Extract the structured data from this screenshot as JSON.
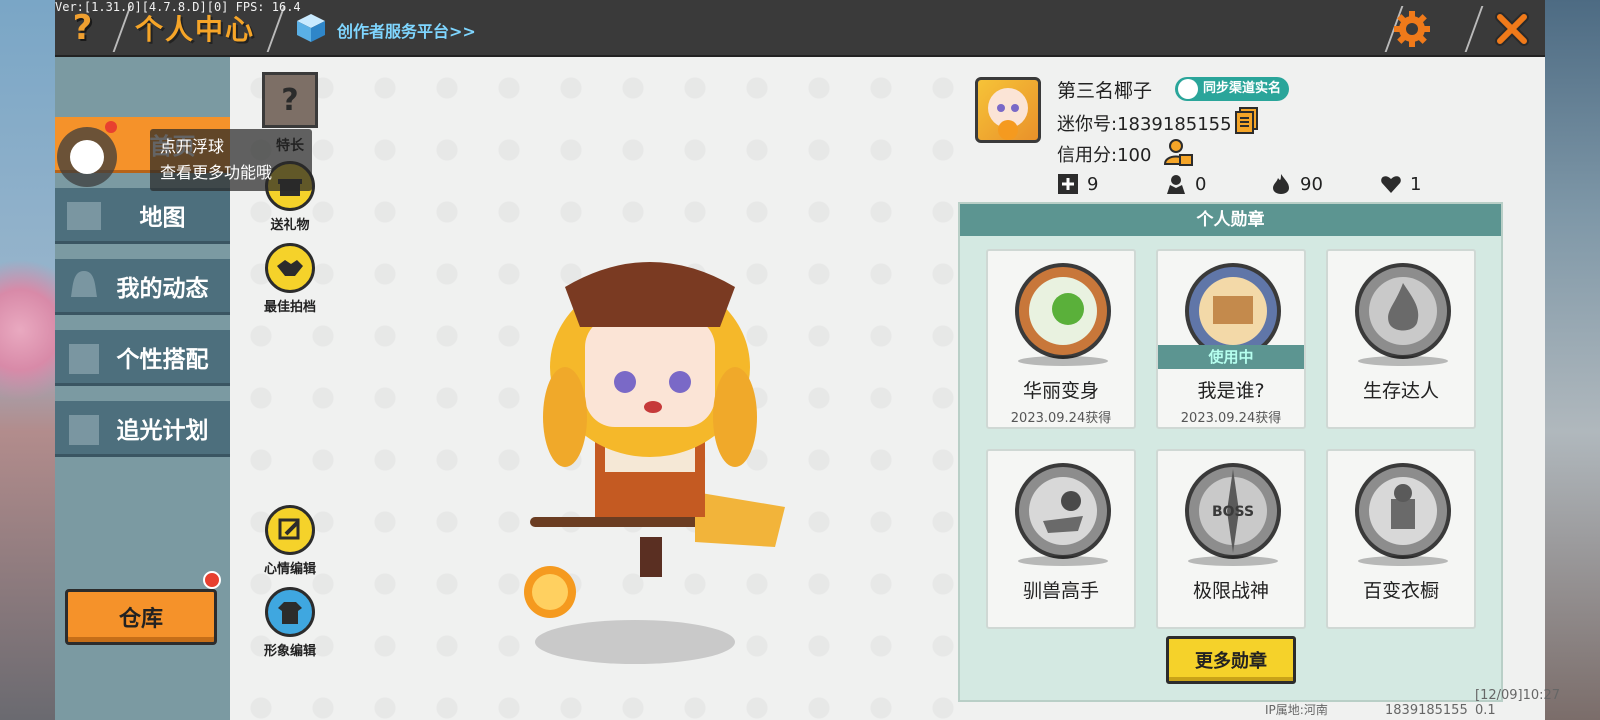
{
  "debug": {
    "version": "Ver:[1.31.0][4.7.8.D][0] FPS: 16.4"
  },
  "header": {
    "help_icon": "question-mark-icon",
    "title": "个人中心",
    "creator_link": "创作者服务平台>>",
    "settings_icon": "gear-icon",
    "close_icon": "close-icon"
  },
  "sidebar": {
    "items": [
      {
        "label": "首页",
        "active": true
      },
      {
        "label": "地图",
        "active": false
      },
      {
        "label": "我的动态",
        "active": false
      },
      {
        "label": "个性搭配",
        "active": false
      },
      {
        "label": "追光计划",
        "active": false
      }
    ],
    "warehouse_label": "仓库"
  },
  "floating_tip": {
    "line1": "点开浮球",
    "line2": "查看更多功能哦"
  },
  "center": {
    "skill_label": "特长",
    "actions": [
      {
        "label": "送礼物",
        "icon": "gift-icon"
      },
      {
        "label": "最佳拍档",
        "icon": "handshake-icon"
      },
      {
        "label": "心情编辑",
        "icon": "edit-icon"
      },
      {
        "label": "形象编辑",
        "icon": "outfit-icon"
      }
    ]
  },
  "profile": {
    "nickname": "第三名椰子",
    "verify_badge": "同步渠道实名",
    "mini_id": "迷你号:1839185155",
    "credit": "信用分:100",
    "stats": [
      {
        "icon": "plus-icon",
        "value": "9"
      },
      {
        "icon": "fans-icon",
        "value": "0"
      },
      {
        "icon": "fire-icon",
        "value": "90"
      },
      {
        "icon": "heart-icon",
        "value": "1"
      }
    ]
  },
  "medals": {
    "title": "个人勋章",
    "items": [
      {
        "name": "华丽变身",
        "date": "2023.09.24获得",
        "in_use": false,
        "color": "#c8773a"
      },
      {
        "name": "我是谁?",
        "date": "2023.09.24获得",
        "in_use": true,
        "in_use_label": "使用中",
        "color": "#6076a8"
      },
      {
        "name": "生存达人",
        "date": "",
        "in_use": false,
        "color": "#8d8d8d"
      },
      {
        "name": "驯兽高手",
        "date": "",
        "in_use": false,
        "color": "#8d8d8d"
      },
      {
        "name": "极限战神",
        "date": "",
        "in_use": false,
        "color": "#8d8d8d"
      },
      {
        "name": "百变衣橱",
        "date": "",
        "in_use": false,
        "color": "#8d8d8d"
      }
    ],
    "more_label": "更多勋章"
  },
  "footer": {
    "ip": "IP属地:河南",
    "id": "1839185155",
    "time": "[12/09]10:27 0.1"
  },
  "colors": {
    "accent": "#f5922a",
    "nav": "#4d6f7d",
    "medal_header": "#5c9591",
    "yellow_btn": "#f5d22a"
  }
}
